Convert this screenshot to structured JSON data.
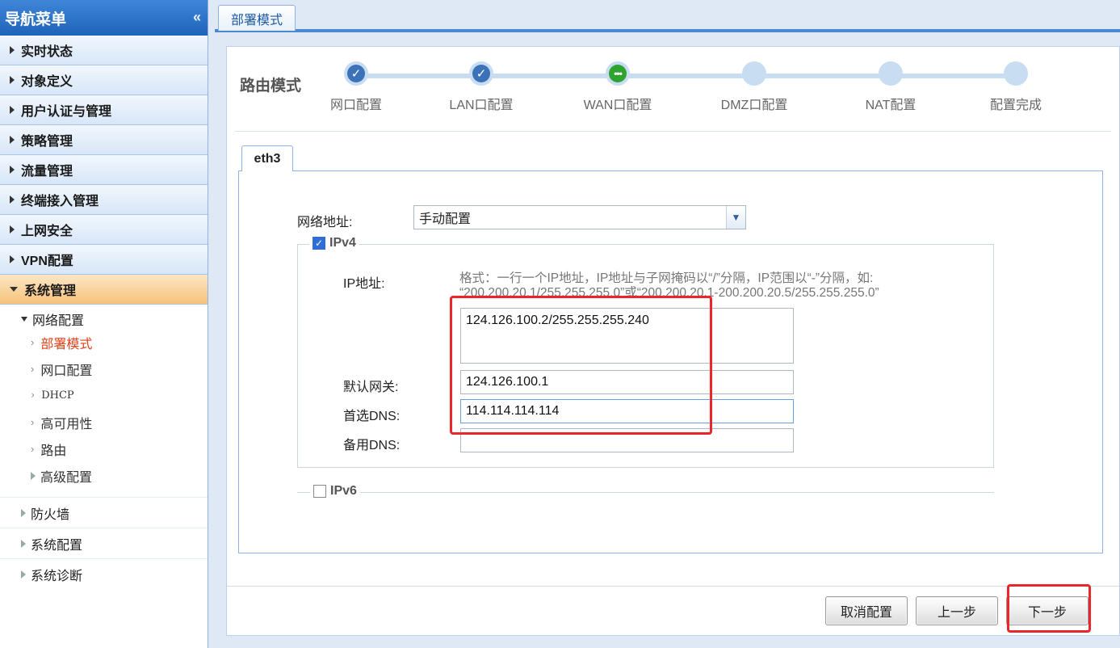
{
  "sidebar": {
    "title": "导航菜单",
    "collapse_glyph": "«",
    "menu": [
      {
        "label": "实时状态"
      },
      {
        "label": "对象定义"
      },
      {
        "label": "用户认证与管理"
      },
      {
        "label": "策略管理"
      },
      {
        "label": "流量管理"
      },
      {
        "label": "终端接入管理"
      },
      {
        "label": "上网安全"
      },
      {
        "label": "VPN配置"
      },
      {
        "label": "系统管理"
      }
    ],
    "sub_group": "网络配置",
    "sub_items": [
      {
        "label": "部署模式"
      },
      {
        "label": "网口配置"
      },
      {
        "label": "DHCP"
      },
      {
        "label": "高可用性"
      },
      {
        "label": "路由"
      },
      {
        "label": "高级配置"
      }
    ],
    "lower_groups": [
      {
        "label": "防火墙"
      },
      {
        "label": "系统配置"
      },
      {
        "label": "系统诊断"
      }
    ]
  },
  "tab": {
    "label": "部署模式"
  },
  "wizard": {
    "mode_title": "路由模式",
    "steps": [
      {
        "label": "网口配置",
        "state": "done"
      },
      {
        "label": "LAN口配置",
        "state": "done"
      },
      {
        "label": "WAN口配置",
        "state": "current"
      },
      {
        "label": "DMZ口配置",
        "state": "pending"
      },
      {
        "label": "NAT配置",
        "state": "pending"
      },
      {
        "label": "配置完成",
        "state": "pending"
      }
    ]
  },
  "form": {
    "interface_tab": "eth3",
    "network_address_label": "网络地址:",
    "network_address_value": "手动配置",
    "ipv4_label": "IPv4",
    "ipv4_checked": true,
    "ip_label": "IP地址:",
    "ip_hint_1": "格式：一行一个IP地址，IP地址与子网掩码以“/”分隔，IP范围以“-”分隔，如:",
    "ip_hint_2": "“200.200.20.1/255.255.255.0”或“200.200.20.1-200.200.20.5/255.255.255.0”",
    "ip_value": "124.126.100.2/255.255.255.240",
    "gateway_label": "默认网关:",
    "gateway_value": "124.126.100.1",
    "dns1_label": "首选DNS:",
    "dns1_value": "114.114.114.114",
    "dns2_label": "备用DNS:",
    "dns2_value": "",
    "ipv6_label": "IPv6",
    "ipv6_checked": false
  },
  "buttons": {
    "cancel": "取消配置",
    "prev": "上一步",
    "next": "下一步"
  },
  "colors": {
    "highlight": "#e8262b",
    "step_done": "#3c72b8",
    "step_current": "#2fa32f",
    "current_menu": "#e0421a"
  }
}
